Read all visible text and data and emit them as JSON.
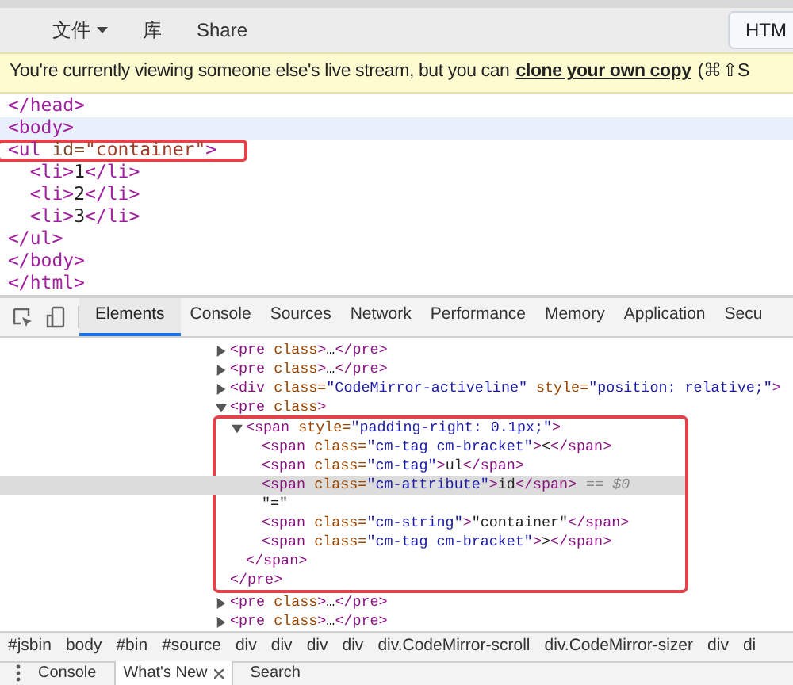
{
  "toolbar": {
    "menus": [
      {
        "label": "文件",
        "dropdown": true
      },
      {
        "label": "库",
        "dropdown": false
      },
      {
        "label": "Share",
        "dropdown": false
      }
    ],
    "right_button": "HTM"
  },
  "banner": {
    "text": "You're currently viewing someone else's live stream, but you can",
    "link": "clone your own copy",
    "after": "(⌘⇧S"
  },
  "editor": {
    "lines": [
      {
        "text": "</head>",
        "highlighted": false,
        "outlined": false
      },
      {
        "text": "<body>",
        "highlighted": true,
        "outlined": false
      },
      {
        "text": "<ul id=\"container\">",
        "highlighted": false,
        "outlined": true
      },
      {
        "text": "  <li>1</li>",
        "highlighted": false,
        "outlined": false
      },
      {
        "text": "  <li>2</li>",
        "highlighted": false,
        "outlined": false
      },
      {
        "text": "  <li>3</li>",
        "highlighted": false,
        "outlined": false
      },
      {
        "text": "</ul>",
        "highlighted": false,
        "outlined": false
      },
      {
        "text": "</body>",
        "highlighted": false,
        "outlined": false
      },
      {
        "text": "</html>",
        "highlighted": false,
        "outlined": false
      }
    ]
  },
  "devtools": {
    "tabs": [
      {
        "label": "Elements",
        "selected": true
      },
      {
        "label": "Console",
        "selected": false
      },
      {
        "label": "Sources",
        "selected": false
      },
      {
        "label": "Network",
        "selected": false
      },
      {
        "label": "Performance",
        "selected": false
      },
      {
        "label": "Memory",
        "selected": false
      },
      {
        "label": "Application",
        "selected": false
      },
      {
        "label": "Secu",
        "selected": false
      }
    ],
    "dom_tree": [
      {
        "open": "<pre class>…</pre>",
        "expanded": false
      },
      {
        "open": "<pre class>…</pre>",
        "expanded": false
      },
      {
        "open": "<div class=\"CodeMirror-activeline\" style=\"position: relative;\">",
        "expanded": false
      },
      {
        "open": "<pre class>",
        "expanded": true,
        "outlined": true,
        "close": "</pre>",
        "children": [
          {
            "open": "<span style=\"padding-right: 0.1px;\">",
            "expanded": true,
            "close": "</span>",
            "children": [
              {
                "open": "<span class=\"cm-tag cm-bracket\"><</span>",
                "selected": false
              },
              {
                "open": "<span class=\"cm-tag\">ul</span>",
                "selected": false
              },
              {
                "open": "<span class=\"cm-attribute\">id</span>",
                "selected": true,
                "suffix": "== $0"
              },
              {
                "open": "\"=\"",
                "selected": false
              },
              {
                "open": "<span class=\"cm-string\">\"container\"</span>",
                "selected": false
              },
              {
                "open": "<span class=\"cm-tag cm-bracket\">></span>",
                "selected": false
              }
            ]
          }
        ]
      },
      {
        "open": "<pre class>…</pre>",
        "expanded": false
      },
      {
        "open": "<pre class>…</pre>",
        "expanded": false
      }
    ],
    "breadcrumbs": [
      "#jsbin",
      "body",
      "#bin",
      "#source",
      "div",
      "div",
      "div",
      "div",
      "div.CodeMirror-scroll",
      "div.CodeMirror-sizer",
      "div",
      "di"
    ],
    "drawer_tabs": [
      {
        "label": "Console",
        "selected": false
      },
      {
        "label": "What's New",
        "selected": true
      },
      {
        "label": "Search",
        "selected": false
      }
    ]
  }
}
